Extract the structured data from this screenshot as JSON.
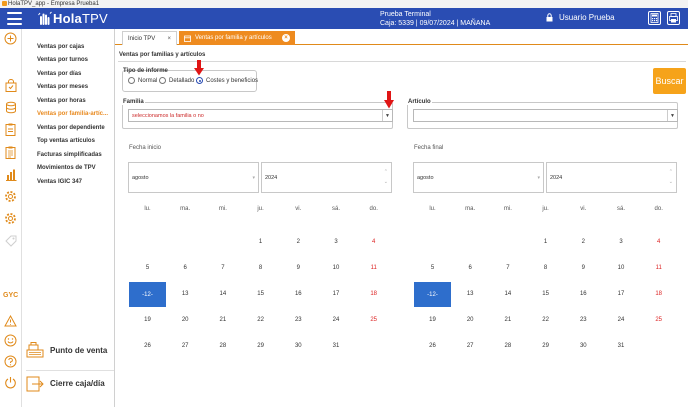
{
  "window": {
    "title": "HolaTPV_app - Empresa Prueba1"
  },
  "header": {
    "logo_brand": "Hola",
    "logo_product": "TPV",
    "terminal_line1": "Prueba Terminal",
    "terminal_line2": "Caja: 5339 | 09/07/2024 | MAÑANA",
    "user": "Usuario Prueba"
  },
  "rail": {
    "gyc_label": "GYC"
  },
  "menu": {
    "items": [
      "Ventas por cajas",
      "Ventas por turnos",
      "Ventas por días",
      "Ventas por meses",
      "Ventas por horas",
      "Ventas por familia-artíc...",
      "Ventas por dependiente",
      "Top ventas artículos",
      "Facturas simplificadas",
      "Movimientos de TPV",
      "Ventas IGIC 347"
    ],
    "active_index": 5,
    "pos_button": "Punto de venta",
    "cierre_button": "Cierre caja/día"
  },
  "tabs": [
    {
      "label": "Inicio TPV",
      "close": "×"
    },
    {
      "label": "Ventas por familia y artículos",
      "close": "×"
    }
  ],
  "page": {
    "title": "Ventas por familias y artículos",
    "tipo_informe": {
      "label": "Tipo de informe",
      "options": [
        "Normal",
        "Detallado",
        "Costes y beneficios"
      ],
      "selected": 2
    },
    "buscar": "Buscar",
    "familia": {
      "label": "Familia",
      "value": "seleccionamos la familia o no"
    },
    "articulo": {
      "label": "Artículo",
      "value": ""
    },
    "fecha_inicio": {
      "label": "Fecha inicio",
      "month": "agosto",
      "year": "2024"
    },
    "fecha_final": {
      "label": "Fecha final",
      "month": "agosto",
      "year": "2024"
    }
  },
  "calendar": {
    "weekdays": [
      "lu.",
      "ma.",
      "mi.",
      "ju.",
      "vi.",
      "sá.",
      "do."
    ],
    "weeks": [
      [
        "",
        "",
        "",
        "1",
        "2",
        "3",
        "4"
      ],
      [
        "5",
        "6",
        "7",
        "8",
        "9",
        "10",
        "11"
      ],
      [
        "-12-",
        "13",
        "14",
        "15",
        "16",
        "17",
        "18"
      ],
      [
        "19",
        "20",
        "21",
        "22",
        "23",
        "24",
        "25"
      ],
      [
        "26",
        "27",
        "28",
        "29",
        "30",
        "31",
        ""
      ]
    ],
    "selected_day": "-12-"
  },
  "colors": {
    "header": "#2a4db3",
    "accent_orange": "#ee8b1f",
    "buscar": "#f6a31a",
    "selected_day": "#2e6ecc",
    "weekend_red": "#dd2424",
    "annotation_arrow": "#e01515"
  },
  "icons": {
    "header": [
      "hamburger-icon",
      "hand-wave-logo-icon",
      "lock-icon",
      "calculator-icon",
      "printer-icon"
    ],
    "rail": [
      "plus-circle-icon",
      "bag-icon",
      "coins-icon",
      "clipboard-icon",
      "clipboard-list-icon",
      "bar-chart-icon",
      "gear-icon",
      "gear-icon",
      "tag-icon",
      "warning-icon",
      "smile-icon",
      "help-icon",
      "power-icon"
    ]
  }
}
